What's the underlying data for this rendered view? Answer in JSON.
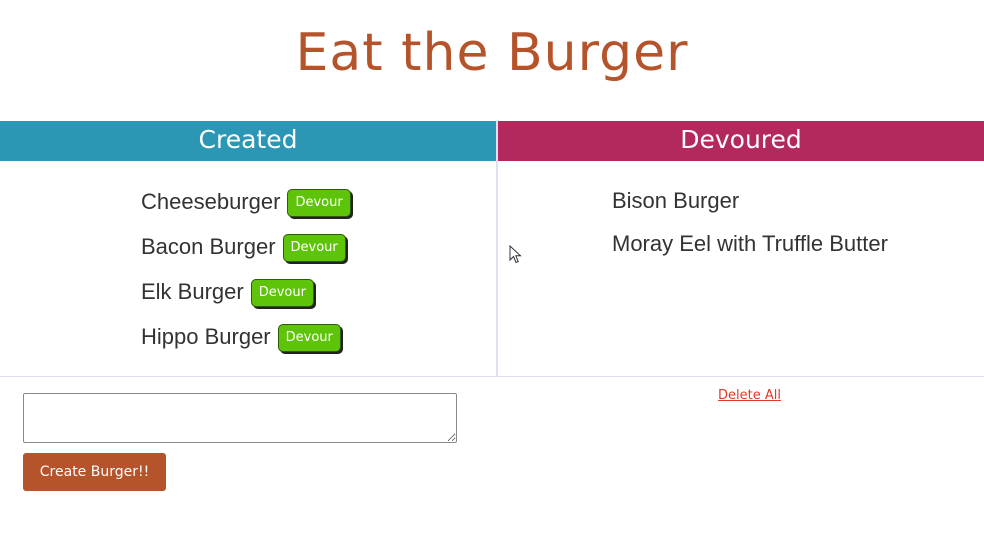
{
  "app": {
    "title": "Eat the Burger"
  },
  "created": {
    "header": "Created",
    "items": [
      {
        "name": "Cheeseburger",
        "button": "Devour"
      },
      {
        "name": "Bacon Burger",
        "button": "Devour"
      },
      {
        "name": "Elk Burger",
        "button": "Devour"
      },
      {
        "name": "Hippo Burger",
        "button": "Devour"
      }
    ]
  },
  "devoured": {
    "header": "Devoured",
    "items": [
      {
        "name": "Bison Burger"
      },
      {
        "name": "Moray Eel with Truffle Butter"
      }
    ]
  },
  "form": {
    "input_value": "",
    "submit_label": "Create Burger!!"
  },
  "actions": {
    "delete_all_label": "Delete All"
  },
  "colors": {
    "title": "#b5532b",
    "created_header": "#2b97b4",
    "devoured_header": "#b3295d",
    "devour_button": "#5ec40a",
    "create_button": "#b5532b",
    "delete_link": "#e03a2a"
  },
  "icons": {
    "cursor": "mouse-pointer-icon"
  }
}
